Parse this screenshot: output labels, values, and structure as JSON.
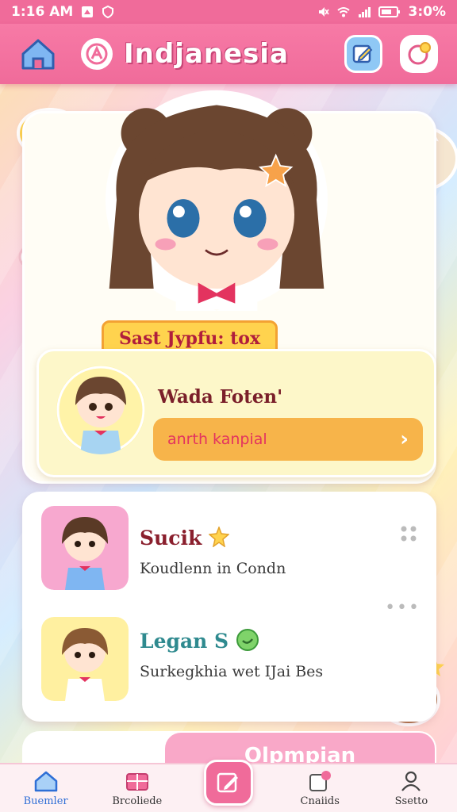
{
  "status_bar": {
    "time": "1:16 AM",
    "battery": "3:0%"
  },
  "header": {
    "title": "Indjanesia",
    "home_icon": "home-icon",
    "logo_icon": "app-logo-icon",
    "edit_icon": "edit-icon",
    "profile_icon": "profile-icon"
  },
  "hero": {
    "tag": "Sast Jypfu: tox"
  },
  "featured": {
    "title": "Wada Foten'",
    "action_label": "anrth kanpial",
    "action_chevron": "›"
  },
  "list": [
    {
      "title": "Sucik",
      "subtitle": "Koudlenn in Condn",
      "title_color": "#8a1f2d",
      "badge": "star"
    },
    {
      "title": "Legan S",
      "subtitle": "Surkegkhia wet IJai Bes",
      "title_color": "#2f8a8f",
      "badge": "green-circle"
    }
  ],
  "bottom_card": {
    "label": "Olpmpian"
  },
  "nav": {
    "items": [
      {
        "label": "Buemler",
        "icon": "home-icon",
        "active": true
      },
      {
        "label": "Brcoliede",
        "icon": "gift-icon",
        "active": false
      },
      {
        "label": "Cnaiids",
        "icon": "cards-icon",
        "active": false
      },
      {
        "label": "Ssetto",
        "icon": "person-icon",
        "active": false
      }
    ],
    "center_icon": "compose-icon"
  },
  "colors": {
    "primary": "#f06b9a",
    "accent_yellow": "#ffd34e",
    "accent_orange": "#f7b44a",
    "nav_active": "#2f6fd6"
  }
}
